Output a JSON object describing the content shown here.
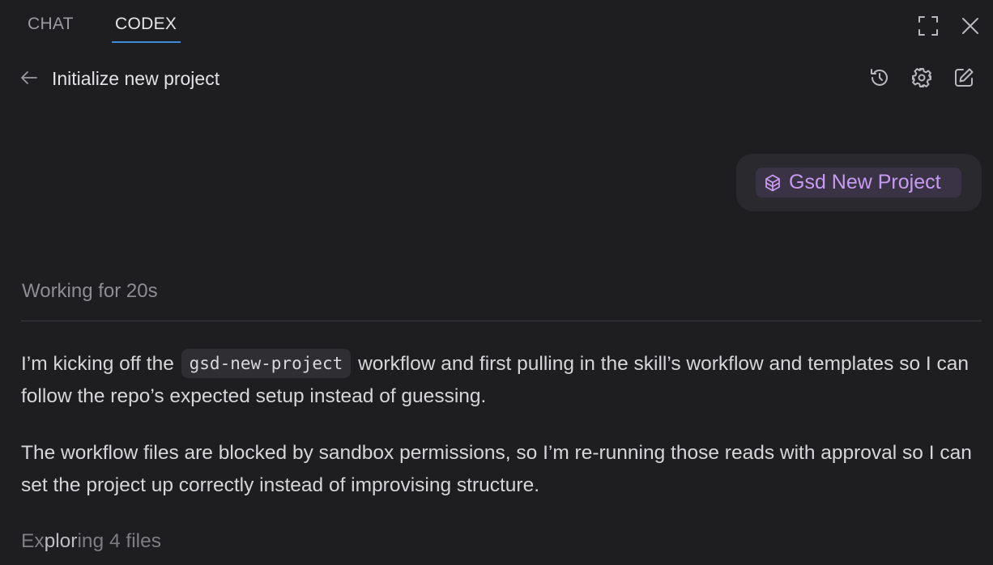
{
  "tabs": [
    {
      "label": "CHAT",
      "active": false
    },
    {
      "label": "CODEX",
      "active": true
    }
  ],
  "window_icons": [
    "expand-icon",
    "close-icon"
  ],
  "header": {
    "title": "Initialize new project",
    "icons": [
      "back-arrow-icon",
      "history-icon",
      "settings-icon",
      "new-chat-icon"
    ]
  },
  "user_message": {
    "skill_label": "Gsd New Project",
    "skill_icon": "cube-stack-icon"
  },
  "status": {
    "working": "Working for 20s"
  },
  "messages": {
    "para1_before": "I’m kicking off the ",
    "para1_code": "gsd-new-project",
    "para1_after": " workflow and first pulling in the skill’s workflow and templates so I can follow the repo’s expected setup instead of guessing.",
    "para2": "The workflow files are blocked by sandbox permissions, so I’m re-running those reads with approval so I can set the project up correctly instead of improvising structure."
  },
  "activity": {
    "prefix": "Ex",
    "highlight": "plor",
    "suffix": "ing 4 files"
  },
  "colors": {
    "background": "#1e1e21",
    "accent_underline": "#3f8ad8",
    "skill_chip_bg": "#3a3245",
    "skill_chip_text": "#c79bf0"
  }
}
